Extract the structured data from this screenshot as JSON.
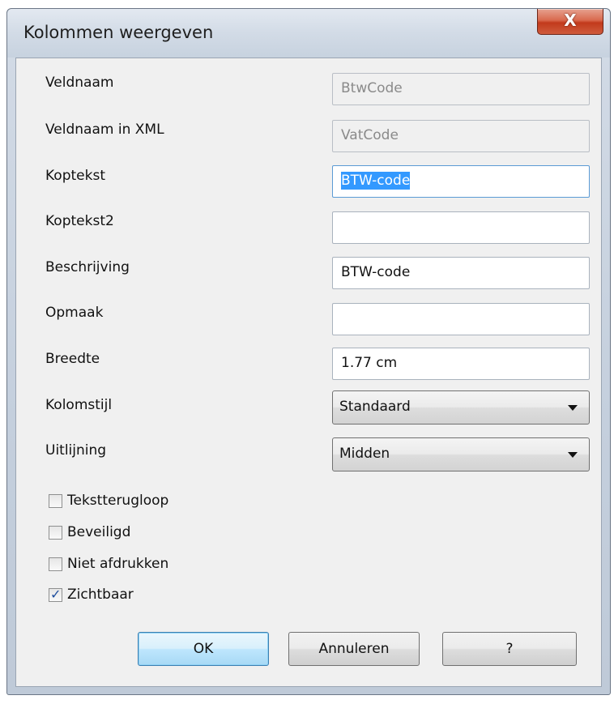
{
  "window": {
    "title": "Kolommen weergeven",
    "close_glyph": "X"
  },
  "fields": [
    {
      "label": "Veldnaam",
      "value": "BtwCode",
      "state": "readonly"
    },
    {
      "label": "Veldnaam in XML",
      "value": "VatCode",
      "state": "readonly"
    },
    {
      "label": "Koptekst",
      "value": "BTW-code",
      "state": "focused-selected"
    },
    {
      "label": "Koptekst2",
      "value": "",
      "state": "editable"
    },
    {
      "label": "Beschrijving",
      "value": "BTW-code",
      "state": "editable"
    },
    {
      "label": "Opmaak",
      "value": "",
      "state": "editable"
    },
    {
      "label": "Breedte",
      "value": "1.77 cm",
      "state": "editable"
    }
  ],
  "combos": [
    {
      "label": "Kolomstijl",
      "value": "Standaard"
    },
    {
      "label": "Uitlijning",
      "value": "Midden"
    }
  ],
  "checkboxes": [
    {
      "label": "Tekstterugloop",
      "checked": false
    },
    {
      "label": "Beveiligd",
      "checked": false
    },
    {
      "label": "Niet afdrukken",
      "checked": false
    },
    {
      "label": "Zichtbaar",
      "checked": true
    }
  ],
  "buttons": {
    "ok": "OK",
    "cancel": "Annuleren",
    "help": "?"
  }
}
